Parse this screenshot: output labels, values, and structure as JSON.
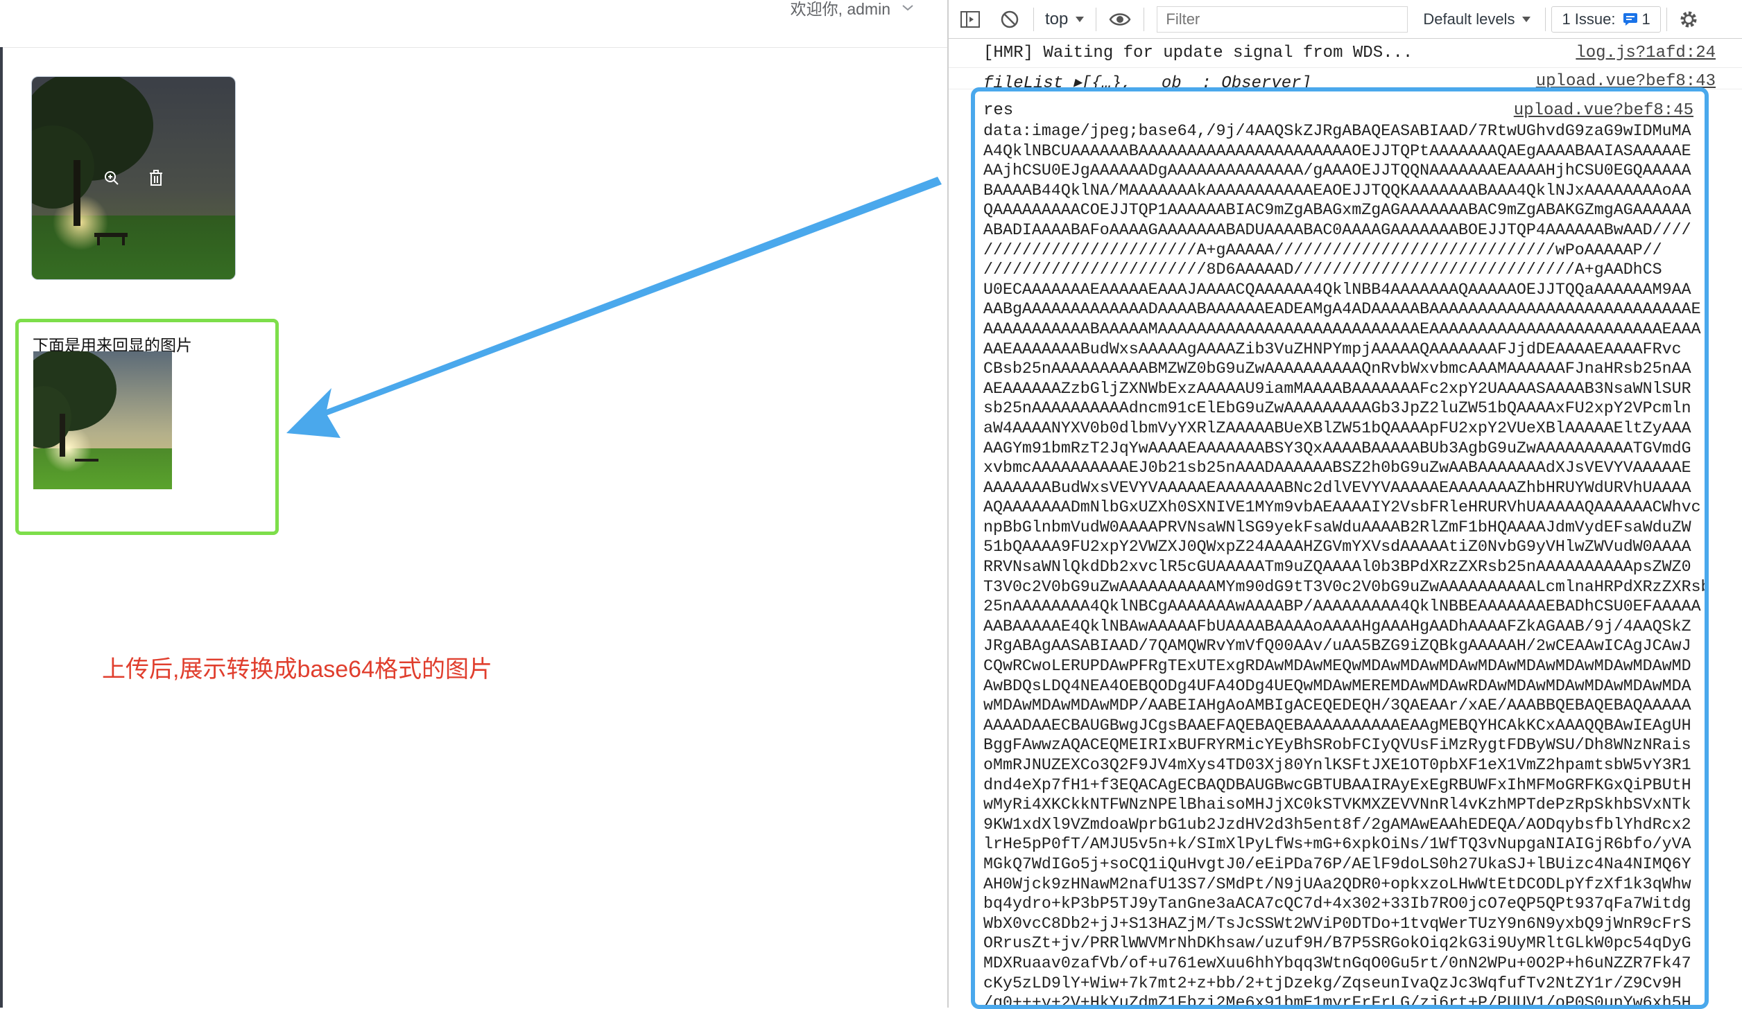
{
  "header": {
    "greeting": "欢迎你, admin",
    "chevron_icon": "chevron-down-icon"
  },
  "upload": {
    "preview_icon": "zoom-in-icon",
    "delete_icon": "trash-icon"
  },
  "echo": {
    "title": "下面是用来回显的图片"
  },
  "annotation": {
    "text": "上传后,展示转换成base64格式的图片",
    "color": "#e03e2d"
  },
  "devtools": {
    "toolbar": {
      "context": "top",
      "filter_placeholder": "Filter",
      "levels": "Default levels",
      "issues_label": "1 Issue:",
      "issues_count": "1"
    },
    "logs": [
      {
        "message": "[HMR] Waiting for update signal from WDS...",
        "source": "log.js?1afd:24"
      },
      {
        "message": "fileList ▸[{…}, __ob__: Observer]",
        "source": "upload.vue?bef8:43"
      }
    ],
    "res": {
      "label": "res",
      "source": "upload.vue?bef8:45",
      "lines": [
        "data:image/jpeg;base64,/9j/4AAQSkZJRgABAQEASABIAAD/7RtwUGhvdG9zaG9wIDMuMA",
        "A4QklNBCUAAAAAABAAAAAAAAAAAAAAAAAAAAAAOEJJTQPtAAAAAAAQAEgAAAABAAIASAAAAAE",
        "AAjhCSU0EJgAAAAAADgAAAAAAAAAAAAAA/gAAAOEJJTQQNAAAAAAAEAAAAHjhCSU0EGQAAAAA",
        "BAAAAB44QklNA/MAAAAAAAkAAAAAAAAAAAEAOEJJTQQKAAAAAAABAAA4QklNJxAAAAAAAAoAA",
        "QAAAAAAAAACOEJJTQP1AAAAAABIAC9mZgABAGxmZgAGAAAAAAABAC9mZgABAKGZmgAGAAAAAA",
        "ABADIAAAABAFoAAAAGAAAAAAABADUAAAABAC0AAAAGAAAAAAABOEJJTQP4AAAAAABwAAD////",
        "//////////////////////A+gAAAAA/////////////////////////////wPoAAAAAP//",
        "///////////////////////8D6AAAAAD/////////////////////////////A+gAADhCS",
        "U0ECAAAAAAAEAAAAAEAAAJAAAACQAAAAAA4QklNBB4AAAAAAAQAAAAAOEJJTQQaAAAAAAM9AA",
        "AABgAAAAAAAAAAAAADAAAABAAAAAAEADEAMgA4ADAAAAABAAAAAAAAAAAAAAAAAAAAAAAAAAAE",
        "AAAAAAAAAAABAAAAAMAAAAAAAAAAAAAAAAAAAAAAAAAAAEAAAAAAAAAAAAAAAAAAAAAAAAEAAA",
        "AAEAAAAAAABudWxsAAAAAgAAAAZib3VuZHNPYmpjAAAAAQAAAAAAAFJjdDEAAAAEAAAAFRvc",
        "CBsb25nAAAAAAAAAABMZWZ0bG9uZwAAAAAAAAAAQnRvbWxvbmcAAAMAAAAAAFJnaHRsb25nAA",
        "AEAAAAAAZzbGljZXNWbExzAAAAAU9iamMAAAABAAAAAAAFc2xpY2UAAAASAAAAB3NsaWNlSUR",
        "sb25nAAAAAAAAAAdncm91cElEbG9uZwAAAAAAAAAGb3JpZ2luZW51bQAAAAxFU2xpY2VPcmln",
        "aW4AAAANYXV0b0dlbmVyYXRlZAAAAABUeXBlZW51bQAAAApFU2xpY2VUeXBlAAAAAEltZyAAA",
        "AAGYm91bmRzT2JqYwAAAAEAAAAAAABSY3QxAAAABAAAAABUb3AgbG9uZwAAAAAAAAAATGVmdG",
        "xvbmcAAAAAAAAAAEJ0b21sb25nAAADAAAAAABSZ2h0bG9uZwAABAAAAAAAdXJsVEVYVAAAAAE",
        "AAAAAAABudWxsVEVYVAAAAAEAAAAAAABNc2dlVEVYVAAAAAEAAAAAAAZhbHRUYWdURVhUAAAA",
        "AQAAAAAAADmNlbGxUZXh0SXNIVE1MYm9vbAEAAAAIY2VsbFRleHRURVhUAAAAAQAAAAAACWhvc",
        "npBbGlnbmVudW0AAAAPRVNsaWNlSG9yekFsaWduAAAAB2RlZmF1bHQAAAAJdmVydEFsaWduZW",
        "51bQAAAA9FU2xpY2VWZXJ0QWxpZ24AAAAHZGVmYXVsdAAAAAtiZ0NvbG9yVHlwZWVudW0AAAA",
        "RRVNsaWNlQkdDb2xvclR5cGUAAAAATm9uZQAAAAl0b3BPdXRzZXRsb25nAAAAAAAAAApsZWZ0",
        "T3V0c2V0bG9uZwAAAAAAAAAAMYm90dG9tT3V0c2V0bG9uZwAAAAAAAAAALcmlnaHRPdXRzZXRsb",
        "25nAAAAAAAA4QklNBCgAAAAAAAwAAAABP/AAAAAAAAA4QklNBBEAAAAAAAEBADhCSU0EFAAAAA",
        "AABAAAAAE4QklNBAwAAAAAFbUAAAABAAAAoAAAAHgAAAHgAADhAAAAFZkAGAAB/9j/4AAQSkZ",
        "JRgABAgAASABIAAD/7QAMQWRvYmVfQ00AAv/uAA5BZG9iZQBkgAAAAAH/2wCEAAwICAgJCAwJ",
        "CQwRCwoLERUPDAwPFRgTExUTExgRDAwMDAwMEQwMDAwMDAwMDAwMDAwMDAwMDAwMDAwMDAwMD",
        "AwBDQsLDQ4NEA4OEBQODg4UFA4ODg4UEQwMDAwMEREMDAwMDAwRDAwMDAwMDAwMDAwMDAwMDA",
        "wMDAwMDAwMDAwMDP/AABEIAHgAoAMBIgACEQEDEQH/3QAEAAr/xAE/AAABBQEBAQEBAQAAAAA",
        "AAAADAAECBAUGBwgJCgsBAAEFAQEBAQEBAAAAAAAAAAEAAgMEBQYHCAkKCxAAAQQBAwIEAgUH",
        "BggFAwwzAQACEQMEIRIxBUFRYRMicYEyBhSRobFCIyQVUsFiMzRygtFDByWSU/Dh8WNzNRais",
        "oMmRJNUZEXCo3Q2F9JV4mXys4TD03Xj80YnlKSFtJXE1OT0pbXF1eX1VmZ2hpamtsbW5vY3R1",
        "dnd4eXp7fH1+f3EQACAgECBAQDBAUGBwcGBTUBAAIRAyExEgRBUWFxIhMFMoGRFKGxQiPBUtH",
        "wMyRi4XKCkkNTFWNzNPElBhaisoMHJjXC0kSTVKMXZEVVNnRl4vKzhMPTdePzRpSkhbSVxNTk",
        "9KW1xdXl9VZmdoaWprbG1ub2JzdHV2d3h5ent8f/2gAMAwEAAhEDEQA/AODqybsfblYhdRcx2",
        "lrHe5pP0fT/AMJU5v5n+k/SImXlPyLfWs+mG+6xpkOiNs/1WfTQ3vNupgaNIAIGjR6bfo/yVA",
        "MGkQ7WdIGo5j+soCQ1iQuHvgtJ0/eEiPDa76P/AElF9doLS0h27UkaSJ+lBUizc4Na4NIMQ6Y",
        "AH0Wjck9zHNawM2nafU13S7/SMdPt/N9jUAa2QDR0+opkxzoLHwWtEtDCODLpYfzXf1k3qWhw",
        "bq4ydro+kP3bP5TJ9yTanGne3aACA7cQC7d+4x302+33Ib7RO0jcO7eQP5QPt937qFa7Witdg",
        "WbX0vcC8Db2+jJ+S13HAZjM/TsJcSSWt2WViP0DTDo+1tvqWerTUzY9n6N9yxbQ9jWnR9cFrS",
        "ORrusZt+jv/PRRlWWVMrNhDKhsaw/uzuf9H/B7P5SRGokOiq2kG3i9UyMRltGLkW0pc54qDyG",
        "MDXRuaav0zafVb/of+u761ewXuu6hhYbqq3WtnGqO0Gu5rt/0nN2WPu+0O2P+h6uNZZR7Fk47",
        "cKy5zLD9lY+Wiw+7k7mt2+z+bb/2+tjDzekg/ZqseunIvaQzJc3WqfufTv2NtZY1r/Z9Cv9H",
        "/g0+++y+2V+HkYuZdmZ1Fbzi2Me6x91bmE1myrFrFrLG/zj6rt+P/PUUV1/oP0S0unYw6xh5H"
      ]
    }
  }
}
